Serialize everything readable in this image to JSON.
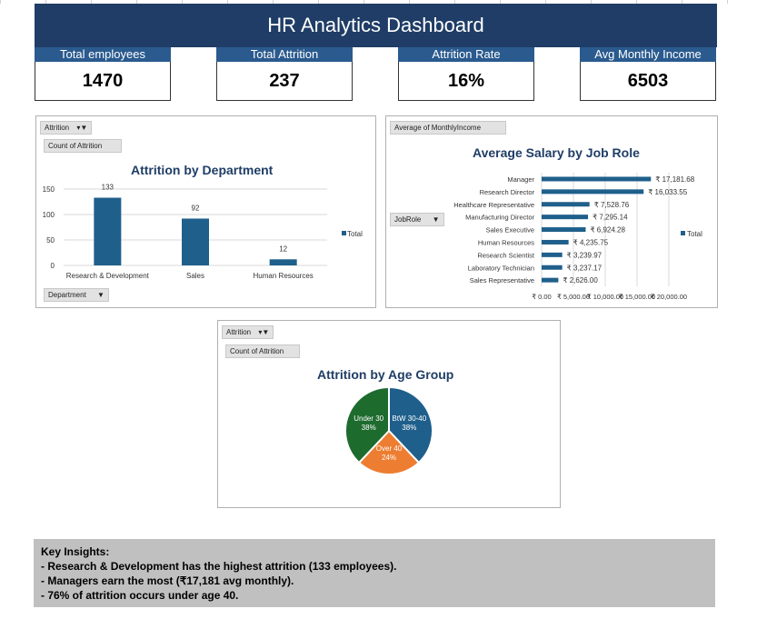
{
  "dashboard": {
    "title": "HR Analytics Dashboard",
    "kpis": [
      {
        "label": "Total employees",
        "value": "1470"
      },
      {
        "label": "Total Attrition",
        "value": "237"
      },
      {
        "label": "Attrition Rate",
        "value": "16%"
      },
      {
        "label": "Avg Monthly Income",
        "value": "6503"
      }
    ]
  },
  "dept_panel": {
    "filter_label": "Attrition",
    "value_field": "Count of Attrition",
    "axis_field": "Department"
  },
  "salary_panel": {
    "value_field": "Average of MonthlyIncome",
    "axis_field": "JobRole"
  },
  "age_panel": {
    "filter_label": "Attrition",
    "value_field": "Count of Attrition"
  },
  "insights": {
    "heading": "Key Insights:",
    "lines": [
      "- Research & Development has the highest attrition (133 employees).",
      "- Managers earn the most (₹17,181 avg monthly).",
      "- 76% of attrition occurs under age 40."
    ]
  },
  "chart_data": [
    {
      "type": "bar",
      "title": "Attrition by Department",
      "categories": [
        "Research & Development",
        "Sales",
        "Human Resources"
      ],
      "series": [
        {
          "name": "Total",
          "values": [
            133,
            92,
            12
          ]
        }
      ],
      "ylim": [
        0,
        150
      ],
      "yticks": [
        0,
        50,
        100,
        150
      ],
      "grid": true,
      "legend": "right",
      "color": "#1f5f8b"
    },
    {
      "type": "bar",
      "orientation": "horizontal",
      "title": "Average Salary by Job Role",
      "categories": [
        "Manager",
        "Research Director",
        "Healthcare Representative",
        "Manufacturing Director",
        "Sales Executive",
        "Human Resources",
        "Research Scientist",
        "Laboratory Technician",
        "Sales Representative"
      ],
      "series": [
        {
          "name": "Total",
          "values": [
            17181.68,
            16033.55,
            7528.76,
            7295.14,
            6924.28,
            4235.75,
            3239.97,
            3237.17,
            2626.0
          ]
        }
      ],
      "value_labels": [
        "₹ 17,181.68",
        "₹ 16,033.55",
        "₹ 7,528.76",
        "₹ 7,295.14",
        "₹ 6,924.28",
        "₹ 4,235.75",
        "₹ 3,239.97",
        "₹ 3,237.17",
        "₹ 2,626.00"
      ],
      "xlim": [
        0,
        20000
      ],
      "xticks": [
        0,
        5000,
        10000,
        15000,
        20000
      ],
      "xtick_labels": [
        "₹ 0.00",
        "₹ 5,000.00",
        "₹ 10,000.00",
        "₹ 15,000.00",
        "₹ 20,000.00"
      ],
      "grid": true,
      "legend": "right",
      "color": "#1f5f8b"
    },
    {
      "type": "pie",
      "title": "Attrition by Age Group",
      "slices": [
        {
          "label": "BtW 30-40",
          "percent": "38%",
          "value": 38,
          "color": "#1f5f8b"
        },
        {
          "label": "Over 40",
          "percent": "24%",
          "value": 24,
          "color": "#ed7d31"
        },
        {
          "label": "Under 30",
          "percent": "38%",
          "value": 38,
          "color": "#1e6b2e"
        }
      ]
    }
  ]
}
